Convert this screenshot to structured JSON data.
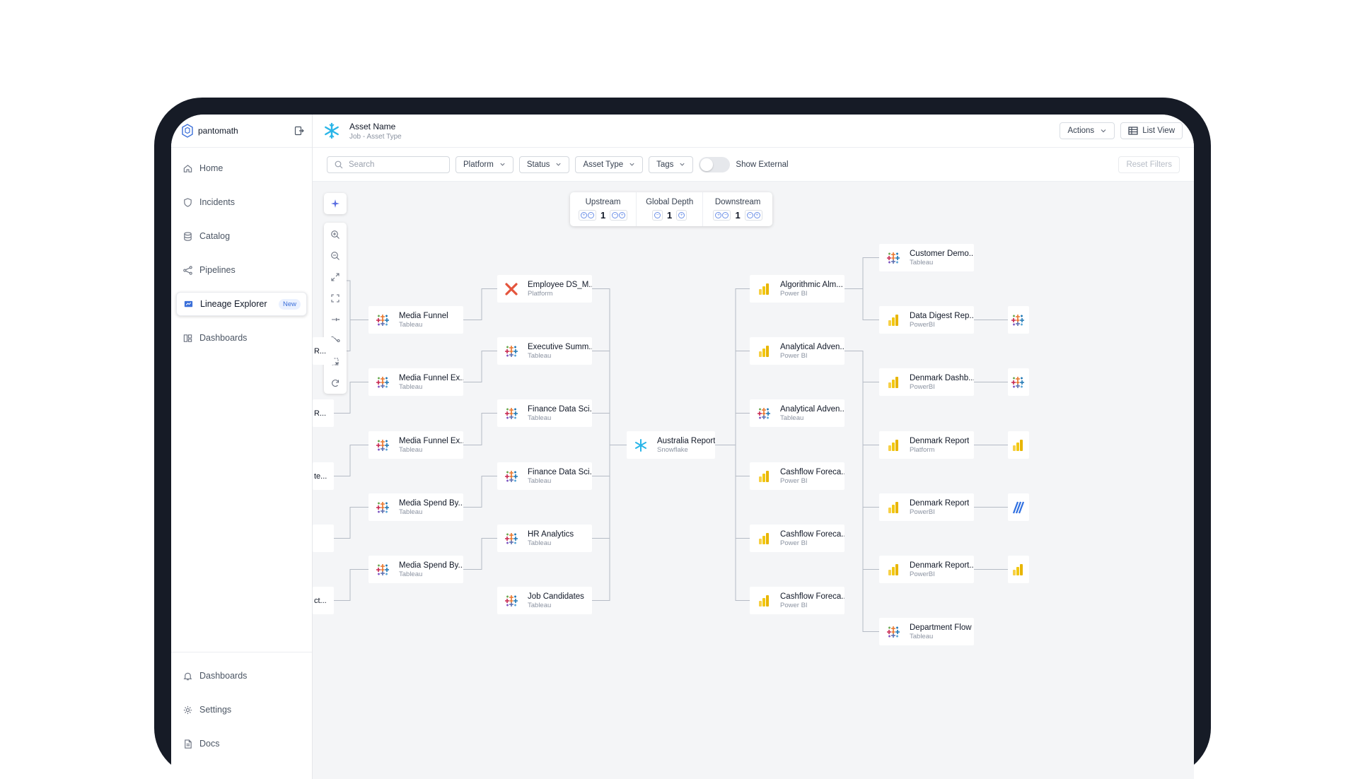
{
  "brand": {
    "name": "pantomath"
  },
  "sidebar": {
    "items": [
      {
        "label": "Home",
        "icon": "home-icon"
      },
      {
        "label": "Incidents",
        "icon": "shield-icon"
      },
      {
        "label": "Catalog",
        "icon": "database-icon"
      },
      {
        "label": "Pipelines",
        "icon": "share-icon"
      },
      {
        "label": "Lineage Explorer",
        "icon": "lineage-icon",
        "badge": "New",
        "active": true
      },
      {
        "label": "Dashboards",
        "icon": "dashboard-icon"
      }
    ],
    "bottom": [
      {
        "label": "Dashboards",
        "icon": "bell-icon"
      },
      {
        "label": "Settings",
        "icon": "gear-icon"
      },
      {
        "label": "Docs",
        "icon": "doc-icon"
      }
    ]
  },
  "header": {
    "asset_name": "Asset Name",
    "asset_type": "Job - Asset Type",
    "actions_label": "Actions",
    "list_view_label": "List View"
  },
  "filters": {
    "search_placeholder": "Search",
    "platform": "Platform",
    "status": "Status",
    "asset_type": "Asset Type",
    "tags": "Tags",
    "show_external": "Show External",
    "show_external_on": false,
    "reset": "Reset Filters"
  },
  "depth": {
    "upstream_label": "Upstream",
    "upstream": "1",
    "global_label": "Global Depth",
    "global": "1",
    "downstream_label": "Downstream",
    "downstream": "1"
  },
  "left_stubs": [
    "R...",
    "R...",
    "te...",
    "",
    "ct..."
  ],
  "nodes": {
    "col1": [
      {
        "name": "Media Funnel",
        "platform": "Tableau",
        "icon": "tableau"
      },
      {
        "name": "Media Funnel Ex...",
        "platform": "Tableau",
        "icon": "tableau"
      },
      {
        "name": "Media Funnel Ex...",
        "platform": "Tableau",
        "icon": "tableau"
      },
      {
        "name": "Media Spend By...",
        "platform": "Tableau",
        "icon": "tableau"
      },
      {
        "name": "Media Spend By...",
        "platform": "Tableau",
        "icon": "tableau"
      }
    ],
    "col2": [
      {
        "name": "Employee DS_M...",
        "platform": "Platform",
        "icon": "platform"
      },
      {
        "name": "Executive Summ...",
        "platform": "Tableau",
        "icon": "tableau"
      },
      {
        "name": "Finance Data Sci...",
        "platform": "Tableau",
        "icon": "tableau"
      },
      {
        "name": "Finance Data Sci...",
        "platform": "Tableau",
        "icon": "tableau"
      },
      {
        "name": "HR Analytics",
        "platform": "Tableau",
        "icon": "tableau"
      },
      {
        "name": "Job Candidates",
        "platform": "Tableau",
        "icon": "tableau"
      }
    ],
    "center": {
      "name": "Australia Report",
      "platform": "Snowflake",
      "icon": "snowflake"
    },
    "col4": [
      {
        "name": "Algorithmic Alm...",
        "platform": "Power BI",
        "icon": "powerbi"
      },
      {
        "name": "Analytical Adven...",
        "platform": "Power BI",
        "icon": "powerbi"
      },
      {
        "name": "Analytical Adven...",
        "platform": "Tableau",
        "icon": "tableau"
      },
      {
        "name": "Cashflow Foreca...",
        "platform": "Power BI",
        "icon": "powerbi"
      },
      {
        "name": "Cashflow Foreca...",
        "platform": "Power BI",
        "icon": "powerbi"
      },
      {
        "name": "Cashflow Foreca...",
        "platform": "Power BI",
        "icon": "powerbi"
      }
    ],
    "col5": [
      {
        "name": "Customer Demo...",
        "platform": "Tableau",
        "icon": "tableau"
      },
      {
        "name": "Data Digest Rep...",
        "platform": "PowerBI",
        "icon": "powerbi"
      },
      {
        "name": "Denmark Dashb...",
        "platform": "PowerBI",
        "icon": "powerbi"
      },
      {
        "name": "Denmark Report",
        "platform": "Platform",
        "icon": "powerbi"
      },
      {
        "name": "Denmark Report",
        "platform": "PowerBI",
        "icon": "powerbi"
      },
      {
        "name": "Denmark Report...",
        "platform": "PowerBI",
        "icon": "powerbi"
      },
      {
        "name": "Department Flow",
        "platform": "Tableau",
        "icon": "tableau"
      }
    ],
    "right_stubs": [
      "tableau",
      "tableau",
      "powerbi",
      "stripe",
      "powerbi"
    ]
  },
  "colors": {
    "accent": "#3b6fd9",
    "tableau_orange": "#e8762d",
    "tableau_blue": "#1f77b4",
    "powerbi": "#f2c811",
    "snowflake": "#29b5e8",
    "platform_red": "#e4553d"
  }
}
